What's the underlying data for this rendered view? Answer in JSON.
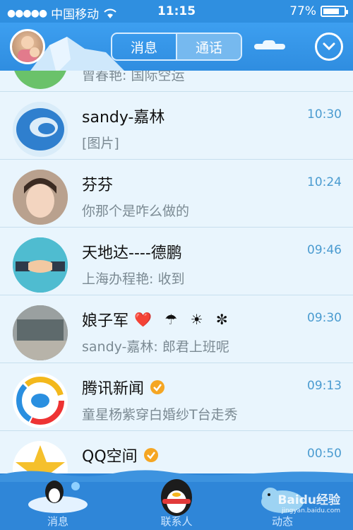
{
  "status_bar": {
    "signal_dots": "●●●●●",
    "carrier": "中国移动",
    "time": "11:15",
    "battery": "77%",
    "battery_level": 0.77
  },
  "header": {
    "tabs": [
      "消息",
      "通话"
    ],
    "active_tab": 0
  },
  "partial_top_message": "曾春艳: 国际空运",
  "conversations": [
    {
      "name": "sandy-嘉林",
      "time": "10:30",
      "message": "[图片]",
      "emojis": "",
      "verified": false,
      "avatar_icon": "chat-logo-icon"
    },
    {
      "name": "芬芬",
      "time": "10:24",
      "message": "你那个是咋么做的",
      "emojis": "",
      "verified": false,
      "avatar_icon": "person-photo"
    },
    {
      "name": "天地达----德鹏",
      "time": "09:46",
      "message": "上海办程艳: 收到",
      "emojis": "",
      "verified": false,
      "avatar_icon": "handshake-icon"
    },
    {
      "name": "娘子军",
      "time": "09:30",
      "message": "sandy-嘉林: 郎君上班呢",
      "emojis": "❤️ ☂ ☀ ✼",
      "verified": false,
      "avatar_icon": "building-photo"
    },
    {
      "name": "腾讯新闻",
      "time": "09:13",
      "message": "童星杨紫穿白婚纱T台走秀",
      "emojis": "",
      "verified": true,
      "avatar_icon": "tencent-news-icon"
    },
    {
      "name": "QQ空间",
      "time": "00:50",
      "message": "",
      "emojis": "",
      "verified": true,
      "avatar_icon": "qzone-star-icon"
    }
  ],
  "bottom_nav": {
    "items": [
      "消息",
      "联系人",
      "动态"
    ]
  },
  "watermark": {
    "brand": "Baidu经验",
    "url": "jingyan.baidu.com"
  }
}
